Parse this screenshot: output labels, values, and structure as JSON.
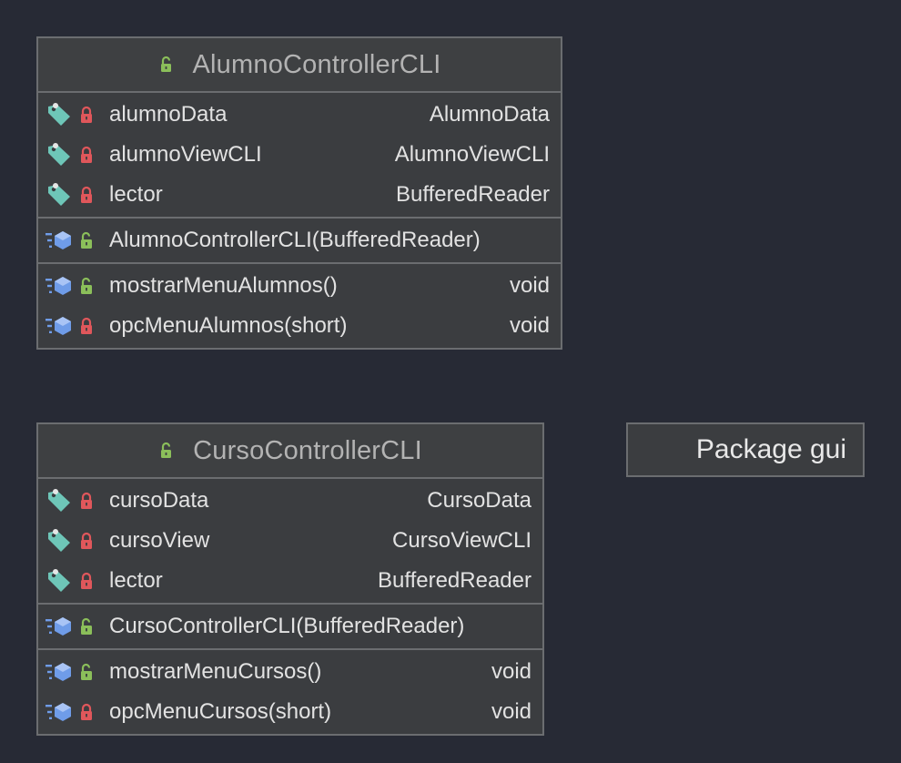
{
  "classes": [
    {
      "name": "AlumnoControllerCLI",
      "fields": [
        {
          "name": "alumnoData",
          "type": "AlumnoData",
          "visibility": "private"
        },
        {
          "name": "alumnoViewCLI",
          "type": "AlumnoViewCLI",
          "visibility": "private"
        },
        {
          "name": "lector",
          "type": "BufferedReader",
          "visibility": "private"
        }
      ],
      "constructors": [
        {
          "name": "AlumnoControllerCLI(BufferedReader)",
          "type": "",
          "visibility": "public"
        }
      ],
      "methods": [
        {
          "name": "mostrarMenuAlumnos()",
          "type": "void",
          "visibility": "public"
        },
        {
          "name": "opcMenuAlumnos(short)",
          "type": "void",
          "visibility": "private"
        }
      ]
    },
    {
      "name": "CursoControllerCLI",
      "fields": [
        {
          "name": "cursoData",
          "type": "CursoData",
          "visibility": "private"
        },
        {
          "name": "cursoView",
          "type": "CursoViewCLI",
          "visibility": "private"
        },
        {
          "name": "lector",
          "type": "BufferedReader",
          "visibility": "private"
        }
      ],
      "constructors": [
        {
          "name": "CursoControllerCLI(BufferedReader)",
          "type": "",
          "visibility": "public"
        }
      ],
      "methods": [
        {
          "name": "mostrarMenuCursos()",
          "type": "void",
          "visibility": "public"
        },
        {
          "name": "opcMenuCursos(short)",
          "type": "void",
          "visibility": "private"
        }
      ]
    }
  ],
  "package": {
    "label": "Package gui"
  },
  "colors": {
    "background": "#272a35",
    "public_lock": "#8bbf5a",
    "private_lock": "#e0575b",
    "field_icon": "#6ec6b8",
    "method_icon": "#6f9ce8"
  },
  "icons": {
    "field": "field-tag-icon",
    "method": "method-icon",
    "public": "unlocked-icon",
    "private": "locked-icon"
  }
}
